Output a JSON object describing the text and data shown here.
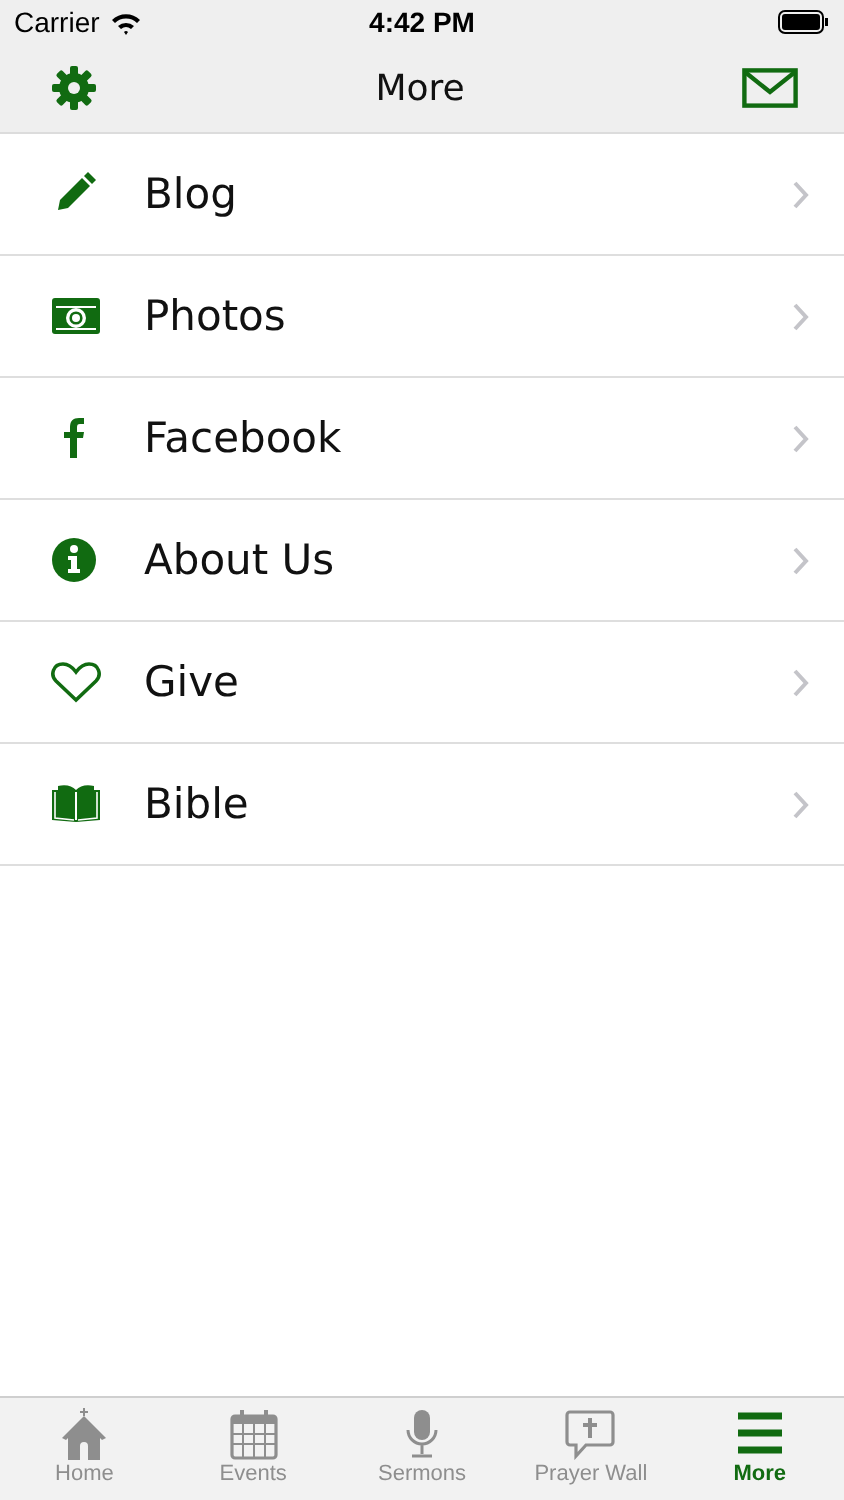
{
  "status_bar": {
    "carrier": "Carrier",
    "time": "4:42 PM"
  },
  "nav_bar": {
    "title": "More"
  },
  "menu": [
    {
      "label": "Blog"
    },
    {
      "label": "Photos"
    },
    {
      "label": "Facebook"
    },
    {
      "label": "About Us"
    },
    {
      "label": "Give"
    },
    {
      "label": "Bible"
    }
  ],
  "tab_bar": [
    {
      "label": "Home",
      "selected": false
    },
    {
      "label": "Events",
      "selected": false
    },
    {
      "label": "Sermons",
      "selected": false
    },
    {
      "label": "Prayer Wall",
      "selected": false
    },
    {
      "label": "More",
      "selected": true
    }
  ]
}
